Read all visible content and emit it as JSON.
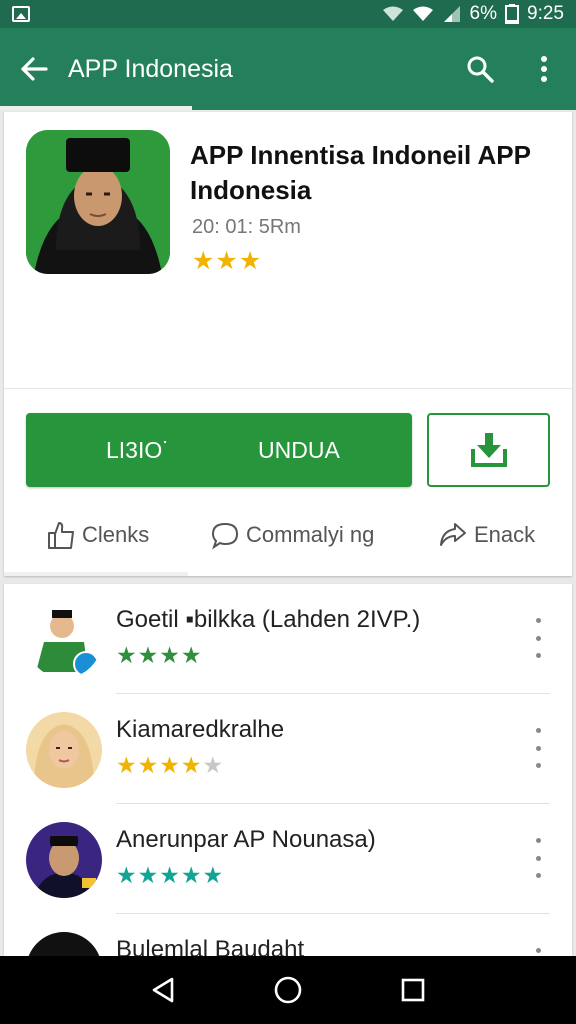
{
  "status_bar": {
    "battery": "6%",
    "time": "9:25"
  },
  "app_bar": {
    "title": "APP Indonesia"
  },
  "app": {
    "title": "APP Innentisa Indoneil APP Indonesia",
    "meta": "20: 01: 5Rm",
    "stars": "★★★",
    "install_left": "LI3IO˙",
    "install_right": "UNDUA"
  },
  "actions": [
    {
      "label": "Clenks",
      "icon": "like-icon"
    },
    {
      "label": "Commalyi ng",
      "icon": "comment-icon"
    },
    {
      "label": "Enack",
      "icon": "share-icon"
    }
  ],
  "list": [
    {
      "name": "Goetil ▪bilkka (Lahden 2IVP.)",
      "stars": "★★★★",
      "star_color": "#2f8f3f"
    },
    {
      "name": "Kiamaredkralhe",
      "stars": "★★★★",
      "star_dim": "★",
      "star_color": "#f0b400"
    },
    {
      "name": "Anerunpar AP Nounasa)",
      "stars": "★★★★★",
      "star_color": "#12a596"
    },
    {
      "name": "Bulemlal Baudaht",
      "stars": "",
      "star_color": "#2f8f3f"
    }
  ],
  "colors": {
    "primary": "#23805a",
    "status": "#1e6b4f",
    "install_green": "#26953c",
    "star_gold": "#f0b400"
  }
}
